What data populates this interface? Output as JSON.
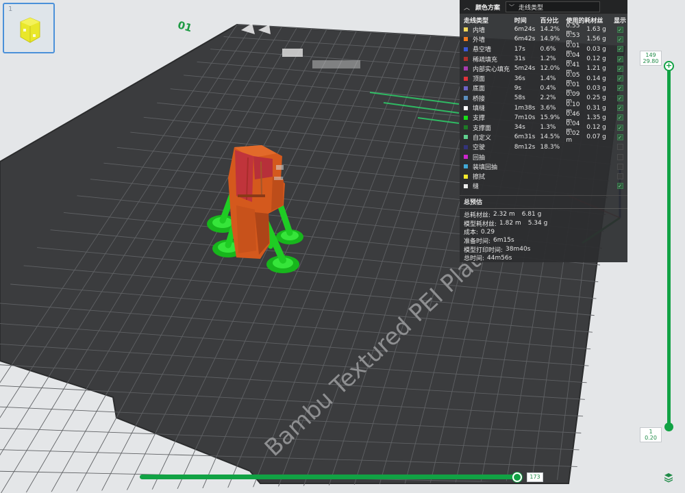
{
  "plate": {
    "index_label": "01",
    "bed_name": "Bambu Textured PEI Plate"
  },
  "thumbnail": {
    "number": "1"
  },
  "legend": {
    "title": "颜色方案",
    "view_type": "走线类型",
    "columns": [
      "走线类型",
      "时间",
      "百分比",
      "使用的耗材丝",
      "显示"
    ],
    "rows": [
      {
        "name": "内墙",
        "time": "6m24s",
        "pct": "14.2%",
        "len": "0.55 m",
        "wt": "1.63 g",
        "color": "#f0d65a",
        "shown": true
      },
      {
        "name": "外墙",
        "time": "6m42s",
        "pct": "14.9%",
        "len": "0.53 m",
        "wt": "1.56 g",
        "color": "#f27b1f",
        "shown": true
      },
      {
        "name": "悬空墙",
        "time": "17s",
        "pct": "0.6%",
        "len": "0.01 m",
        "wt": "0.03 g",
        "color": "#3a58d6",
        "shown": true
      },
      {
        "name": "稀疏填充",
        "time": "31s",
        "pct": "1.2%",
        "len": "0.04 m",
        "wt": "0.12 g",
        "color": "#b0302c",
        "shown": true
      },
      {
        "name": "内部实心填充",
        "time": "5m24s",
        "pct": "12.0%",
        "len": "0.41 m",
        "wt": "1.21 g",
        "color": "#a83bb0",
        "shown": true
      },
      {
        "name": "顶面",
        "time": "36s",
        "pct": "1.4%",
        "len": "0.05 m",
        "wt": "0.14 g",
        "color": "#e0333b",
        "shown": true
      },
      {
        "name": "底面",
        "time": "9s",
        "pct": "0.4%",
        "len": "0.01 m",
        "wt": "0.03 g",
        "color": "#6e64c8",
        "shown": true
      },
      {
        "name": "桥接",
        "time": "58s",
        "pct": "2.2%",
        "len": "0.09 m",
        "wt": "0.25 g",
        "color": "#5b8fbe",
        "shown": true
      },
      {
        "name": "填缝",
        "time": "1m38s",
        "pct": "3.6%",
        "len": "0.10 m",
        "wt": "0.31 g",
        "color": "#ffffff",
        "shown": true
      },
      {
        "name": "支撑",
        "time": "7m10s",
        "pct": "15.9%",
        "len": "0.46 m",
        "wt": "1.35 g",
        "color": "#19e019",
        "shown": true
      },
      {
        "name": "支撑面",
        "time": "34s",
        "pct": "1.3%",
        "len": "0.04 m",
        "wt": "0.12 g",
        "color": "#1e7a26",
        "shown": true
      },
      {
        "name": "自定义",
        "time": "6m31s",
        "pct": "14.5%",
        "len": "0.02 m",
        "wt": "0.07 g",
        "color": "#5fd08e",
        "shown": true
      },
      {
        "name": "空驶",
        "time": "8m12s",
        "pct": "18.3%",
        "len": "",
        "wt": "",
        "color": "#33337a",
        "shown": false
      },
      {
        "name": "回抽",
        "time": "",
        "pct": "",
        "len": "",
        "wt": "",
        "color": "#cc26cc",
        "shown": false
      },
      {
        "name": "装填回抽",
        "time": "",
        "pct": "",
        "len": "",
        "wt": "",
        "color": "#41a8d6",
        "shown": false
      },
      {
        "name": "擦拭",
        "time": "",
        "pct": "",
        "len": "",
        "wt": "",
        "color": "#f2e82c",
        "shown": false
      },
      {
        "name": "缝",
        "time": "",
        "pct": "",
        "len": "",
        "wt": "",
        "color": "#ececec",
        "shown": true
      }
    ],
    "summary_title": "总预估",
    "summary": [
      {
        "label": "总耗材丝:",
        "v1": "2.32 m",
        "v2": "6.81 g"
      },
      {
        "label": "模型耗材丝:",
        "v1": "1.82 m",
        "v2": "5.34 g"
      },
      {
        "label": "成本:",
        "v1": "0.29",
        "v2": ""
      },
      {
        "label": "准备时间:",
        "v1": "6m15s",
        "v2": ""
      },
      {
        "label": "模型打印时间:",
        "v1": "38m40s",
        "v2": ""
      },
      {
        "label": "总时间:",
        "v1": "44m56s",
        "v2": ""
      }
    ]
  },
  "layer_slider": {
    "top_layer": "149",
    "top_height": "29.80",
    "bottom_layer": "1",
    "bottom_height": "0.20"
  },
  "move_slider": {
    "value": "173"
  },
  "colors": {
    "accent": "#11a244",
    "bed": "#3d3e40",
    "bed_grid": "#5b5d60",
    "model_wall": "#d45a1c",
    "support": "#22cc22"
  }
}
